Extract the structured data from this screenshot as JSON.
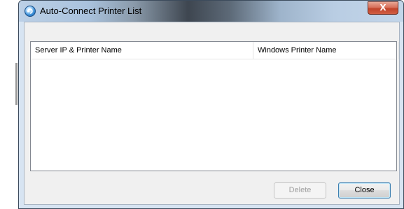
{
  "window": {
    "title": "Auto-Connect Printer List",
    "close_glyph": "X",
    "app_icon": "printer-connect-icon"
  },
  "listview": {
    "columns": [
      {
        "label": "Server IP & Printer Name"
      },
      {
        "label": "Windows Printer Name"
      }
    ],
    "rows": []
  },
  "buttons": {
    "delete_label": "Delete",
    "delete_enabled": false,
    "close_label": "Close"
  },
  "colors": {
    "window_frame": "#d7e4f2",
    "client_bg": "#f0f0f0",
    "close_button_red": "#c1442b",
    "default_button_border": "#3c7fb1"
  }
}
